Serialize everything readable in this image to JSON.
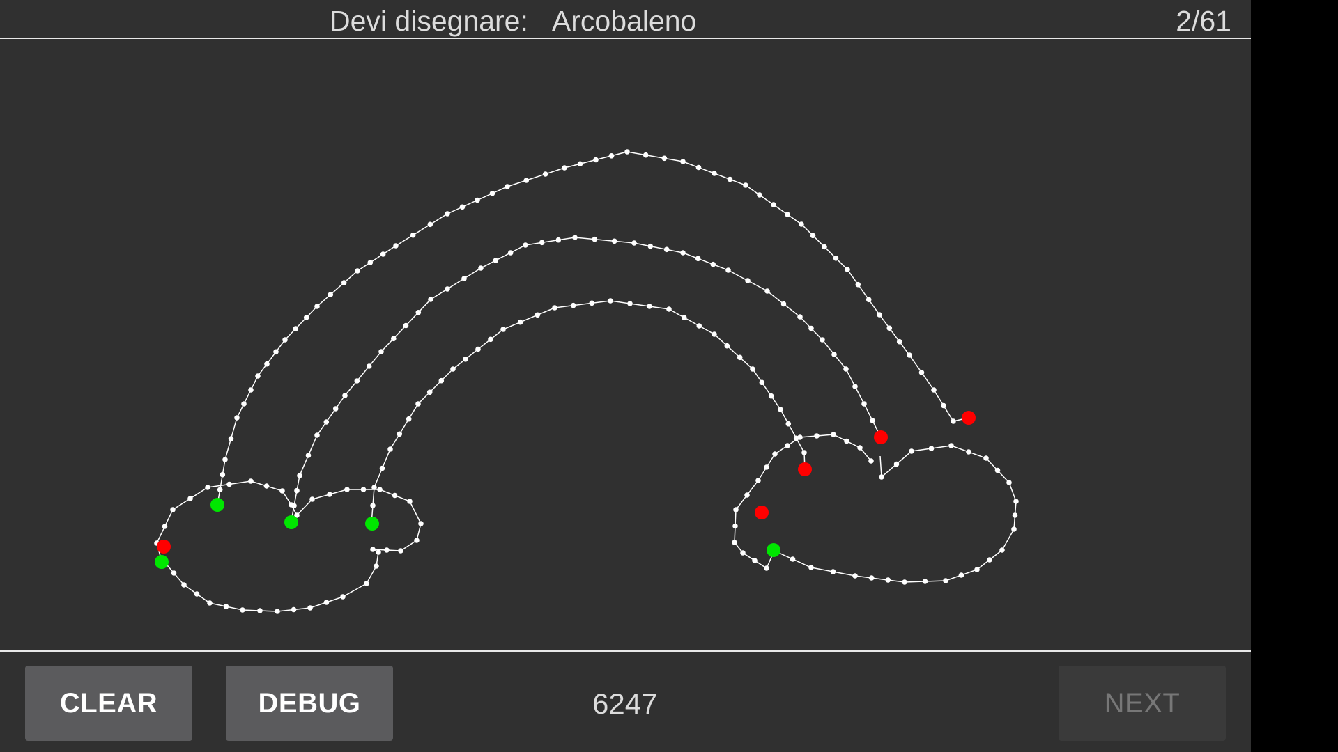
{
  "header": {
    "prompt_label": "Devi disegnare:",
    "prompt_word": "Arcobaleno",
    "progress": "2/61"
  },
  "footer": {
    "clear_label": "CLEAR",
    "debug_label": "DEBUG",
    "score": "6247",
    "next_label": "NEXT"
  },
  "colors": {
    "background": "#303030",
    "stroke": "#ffffff",
    "start_point": "#00e600",
    "end_point": "#ff0000",
    "button": "#5b5b5d",
    "button_disabled": "#3a3a3a"
  }
}
